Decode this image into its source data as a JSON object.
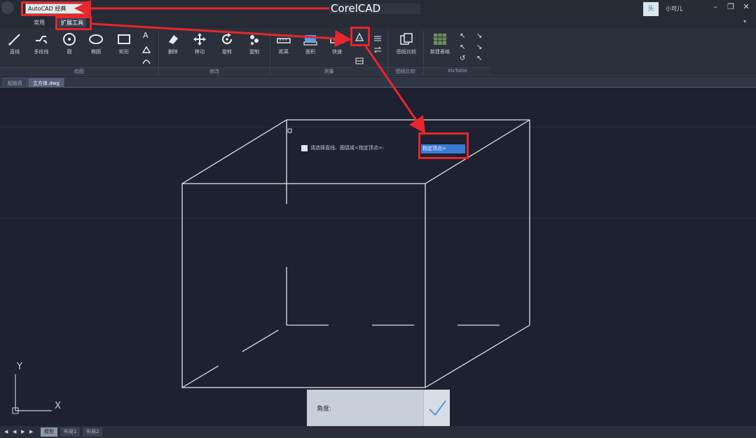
{
  "titlebar": {
    "workspace": "AutoCAD 经典",
    "app_title": "CorelCAD",
    "user_name": "小可儿",
    "avatar_text": "头"
  },
  "ribbon_tabs": [
    {
      "label": "常用",
      "active": false
    },
    {
      "label": "扩展工具",
      "active": true
    }
  ],
  "ribbon": {
    "draw": {
      "label": "绘图",
      "items": [
        "直线",
        "多段线",
        "圆",
        "椭圆",
        "矩形"
      ]
    },
    "modify": {
      "label": "修改",
      "items": [
        "删除",
        "移动",
        "旋转",
        "复制"
      ]
    },
    "measure": {
      "label": "测量",
      "items": [
        "距离",
        "面积",
        "快速"
      ]
    },
    "compare": {
      "label": "图纸比较",
      "items": [
        "图纸比较"
      ]
    },
    "table": {
      "label": "XlsTable",
      "items": [
        "新建表格"
      ]
    }
  },
  "doc_tabs": [
    {
      "label": "起始页",
      "active": false
    },
    {
      "label": "立方体.dwg",
      "active": true
    }
  ],
  "command": {
    "prompt": "请选择直线、圆弧或<指定顶点>:",
    "input": "指定顶点>"
  },
  "angle_panel": {
    "label": "角度:"
  },
  "ucs": {
    "y": "Y",
    "x": "X"
  },
  "layout_tabs": [
    {
      "label": "模型",
      "active": true
    },
    {
      "label": "布局1",
      "active": false
    },
    {
      "label": "布局2",
      "active": false
    }
  ],
  "colors": {
    "annotation": "#e8262b",
    "canvas_bg": "#1d2130",
    "accent": "#3b7bd6"
  }
}
